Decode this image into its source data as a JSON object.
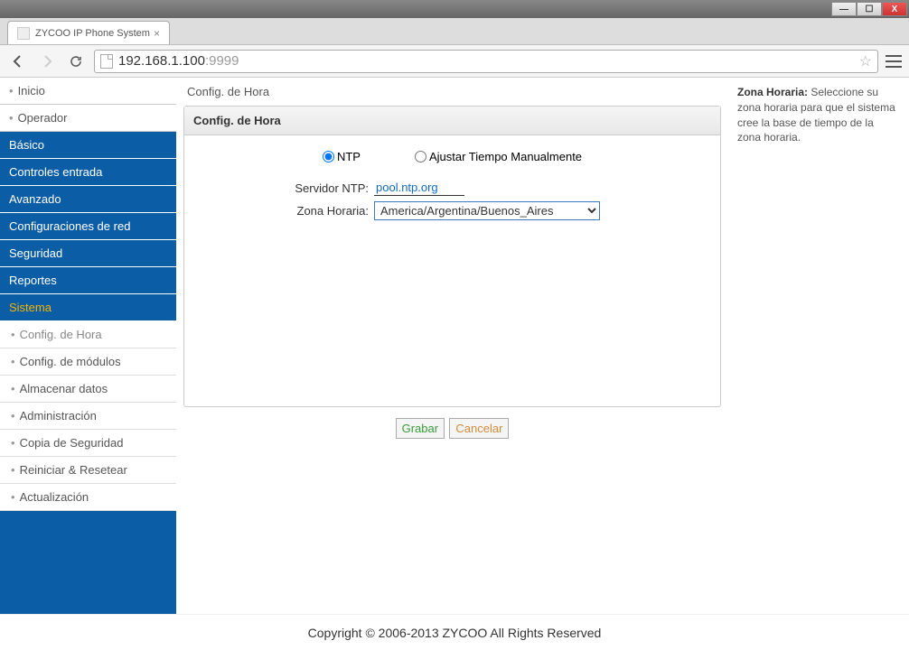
{
  "window": {
    "tab_title": "ZYCOO IP Phone System",
    "url_host": "192.168.1.100",
    "url_port": ":9999"
  },
  "sidebar": {
    "items": [
      {
        "label": "Inicio",
        "type": "white"
      },
      {
        "label": "Operador",
        "type": "white"
      },
      {
        "label": "Básico",
        "type": "blue"
      },
      {
        "label": "Controles entrada",
        "type": "blue"
      },
      {
        "label": "Avanzado",
        "type": "blue"
      },
      {
        "label": "Configuraciones de red",
        "type": "blue"
      },
      {
        "label": "Seguridad",
        "type": "blue"
      },
      {
        "label": "Reportes",
        "type": "blue"
      },
      {
        "label": "Sistema",
        "type": "active"
      }
    ],
    "sub": [
      {
        "label": "Config. de Hora",
        "highlight": true
      },
      {
        "label": "Config. de módulos"
      },
      {
        "label": "Almacenar datos"
      },
      {
        "label": "Administración"
      },
      {
        "label": "Copia de Seguridad"
      },
      {
        "label": "Reiniciar & Resetear"
      },
      {
        "label": "Actualización"
      }
    ]
  },
  "main": {
    "breadcrumb": "Config. de Hora",
    "panel_title": "Config. de Hora",
    "radio": {
      "ntp": "NTP",
      "manual": "Ajustar Tiempo Manualmente"
    },
    "form": {
      "ntp_server_label": "Servidor NTP:",
      "ntp_server_value": "pool.ntp.org",
      "tz_label": "Zona Horaria:",
      "tz_value": "America/Argentina/Buenos_Aires"
    },
    "buttons": {
      "save": "Grabar",
      "cancel": "Cancelar"
    }
  },
  "help": {
    "title": "Zona Horaria:",
    "text": " Seleccione su zona horaria para que el sistema cree la base de tiempo de la zona horaria."
  },
  "footer": {
    "copyright": "Copyright © 2006-2013 ZYCOO All Rights Reserved"
  }
}
